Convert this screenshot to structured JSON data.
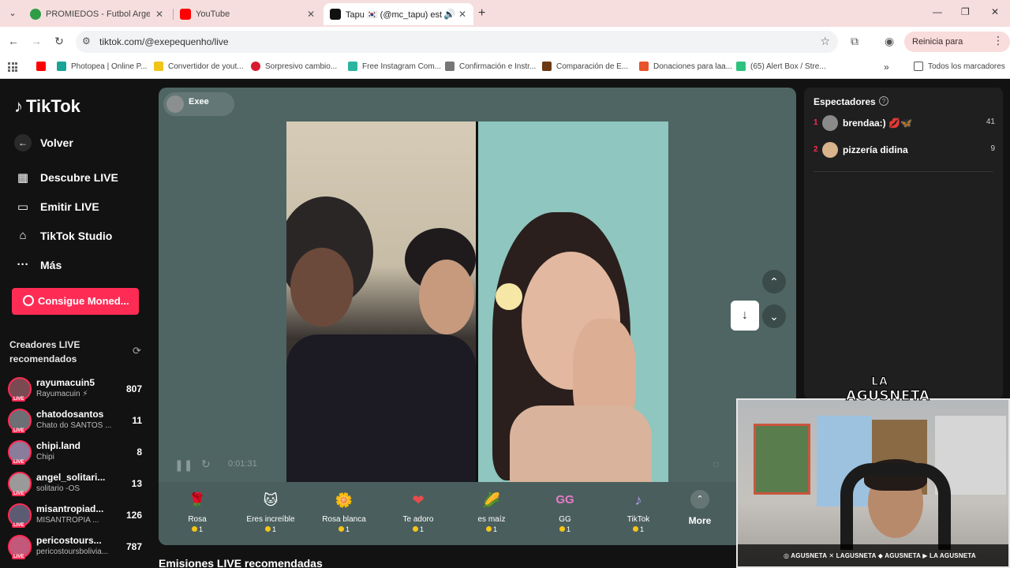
{
  "browser": {
    "tabs": [
      {
        "title": "PROMIEDOS - Futbol Argentino",
        "color": "#2e9d45"
      },
      {
        "title": "YouTube",
        "color": "#ff0000"
      },
      {
        "title": "Tapu 🇰🇷 (@mc_tapu) está en",
        "color": "#111111"
      }
    ],
    "url": "tiktok.com/@exepequenho/live",
    "update_label": "Reinicia para actualizar",
    "bookmarks": [
      {
        "label": "Photopea | Online P...",
        "color": "#18a497"
      },
      {
        "label": "Convertidor de yout...",
        "color": "#f0c419"
      },
      {
        "label": "Sorpresivo cambio...",
        "color": "#d81b30"
      },
      {
        "label": "Free Instagram Com...",
        "color": "#2bb5a0"
      },
      {
        "label": "Confirmación e Instr...",
        "color": "#777777"
      },
      {
        "label": "Comparación de E...",
        "color": "#6b3a14"
      },
      {
        "label": "Donaciones para laa...",
        "color": "#e8542b"
      },
      {
        "label": "(65) Alert Box / Stre...",
        "color": "#2ec27e"
      }
    ],
    "all_bookmarks": "Todos los marcadores"
  },
  "sidebar": {
    "logo": "TikTok",
    "nav": [
      {
        "icon": "arrow-left",
        "label": "Volver"
      },
      {
        "icon": "calendar",
        "label": "Descubre LIVE"
      },
      {
        "icon": "camera",
        "label": "Emitir LIVE"
      },
      {
        "icon": "studio",
        "label": "TikTok Studio"
      },
      {
        "icon": "dots",
        "label": "Más"
      }
    ],
    "coins_button": "Consigue Moned...",
    "creators_title": "Creadores LIVE recomendados",
    "creators": [
      {
        "name": "rayumacuin5",
        "sub": "Rayumacuin ⚡",
        "count": "807",
        "color": "#7a4a52"
      },
      {
        "name": "chatodosantos",
        "sub": "Chato do SANTOS ...",
        "count": "11",
        "color": "#6c6f73"
      },
      {
        "name": "chipi.land",
        "sub": "Chipi",
        "count": "8",
        "color": "#8a7d9b"
      },
      {
        "name": "angel_solitari...",
        "sub": "solitario -OS",
        "count": "13",
        "color": "#9a9a9a"
      },
      {
        "name": "misantropiad...",
        "sub": "MISANTROPIA ...",
        "count": "126",
        "color": "#5b5b73"
      },
      {
        "name": "pericostours...",
        "sub": "pericostoursbolivia...",
        "count": "787",
        "color": "#c2587a"
      }
    ]
  },
  "live": {
    "host": "Exee",
    "timer": "0:01:31",
    "gifts": [
      {
        "name": "Rosa",
        "price": "1",
        "icon": "🌹",
        "color": "#e0306a"
      },
      {
        "name": "Eres increíble",
        "price": "1",
        "icon": "🐱",
        "color": "#c98a4b"
      },
      {
        "name": "Rosa blanca",
        "price": "1",
        "icon": "🌼",
        "color": "#f0efe6"
      },
      {
        "name": "Te adoro",
        "price": "1",
        "icon": "❤",
        "color": "#e84c4c"
      },
      {
        "name": "es maíz",
        "price": "1",
        "icon": "🌽",
        "color": "#f2c94c"
      },
      {
        "name": "GG",
        "price": "1",
        "icon": "GG",
        "color": "#e87ac7"
      },
      {
        "name": "TikTok",
        "price": "1",
        "icon": "♪",
        "color": "#b59cf0"
      }
    ],
    "more_label": "More",
    "recommended_title": "Emisiones LIVE recomendadas"
  },
  "viewers": {
    "title": "Espectadores",
    "list": [
      {
        "rank": "1",
        "name": "brendaa:) 💋🦋",
        "score": "41",
        "color": "#8a8a8a"
      },
      {
        "rank": "2",
        "name": "pizzería didina",
        "score": "9",
        "color": "#d9b38c"
      }
    ]
  },
  "overlay": {
    "brand_top": "LA",
    "brand_bottom": "AGUSNETA",
    "socials": "◎ AGUSNETA   ✕ LAGUSNETA   ◆ AGUSNETA   ▶ LA AGUSNETA"
  }
}
